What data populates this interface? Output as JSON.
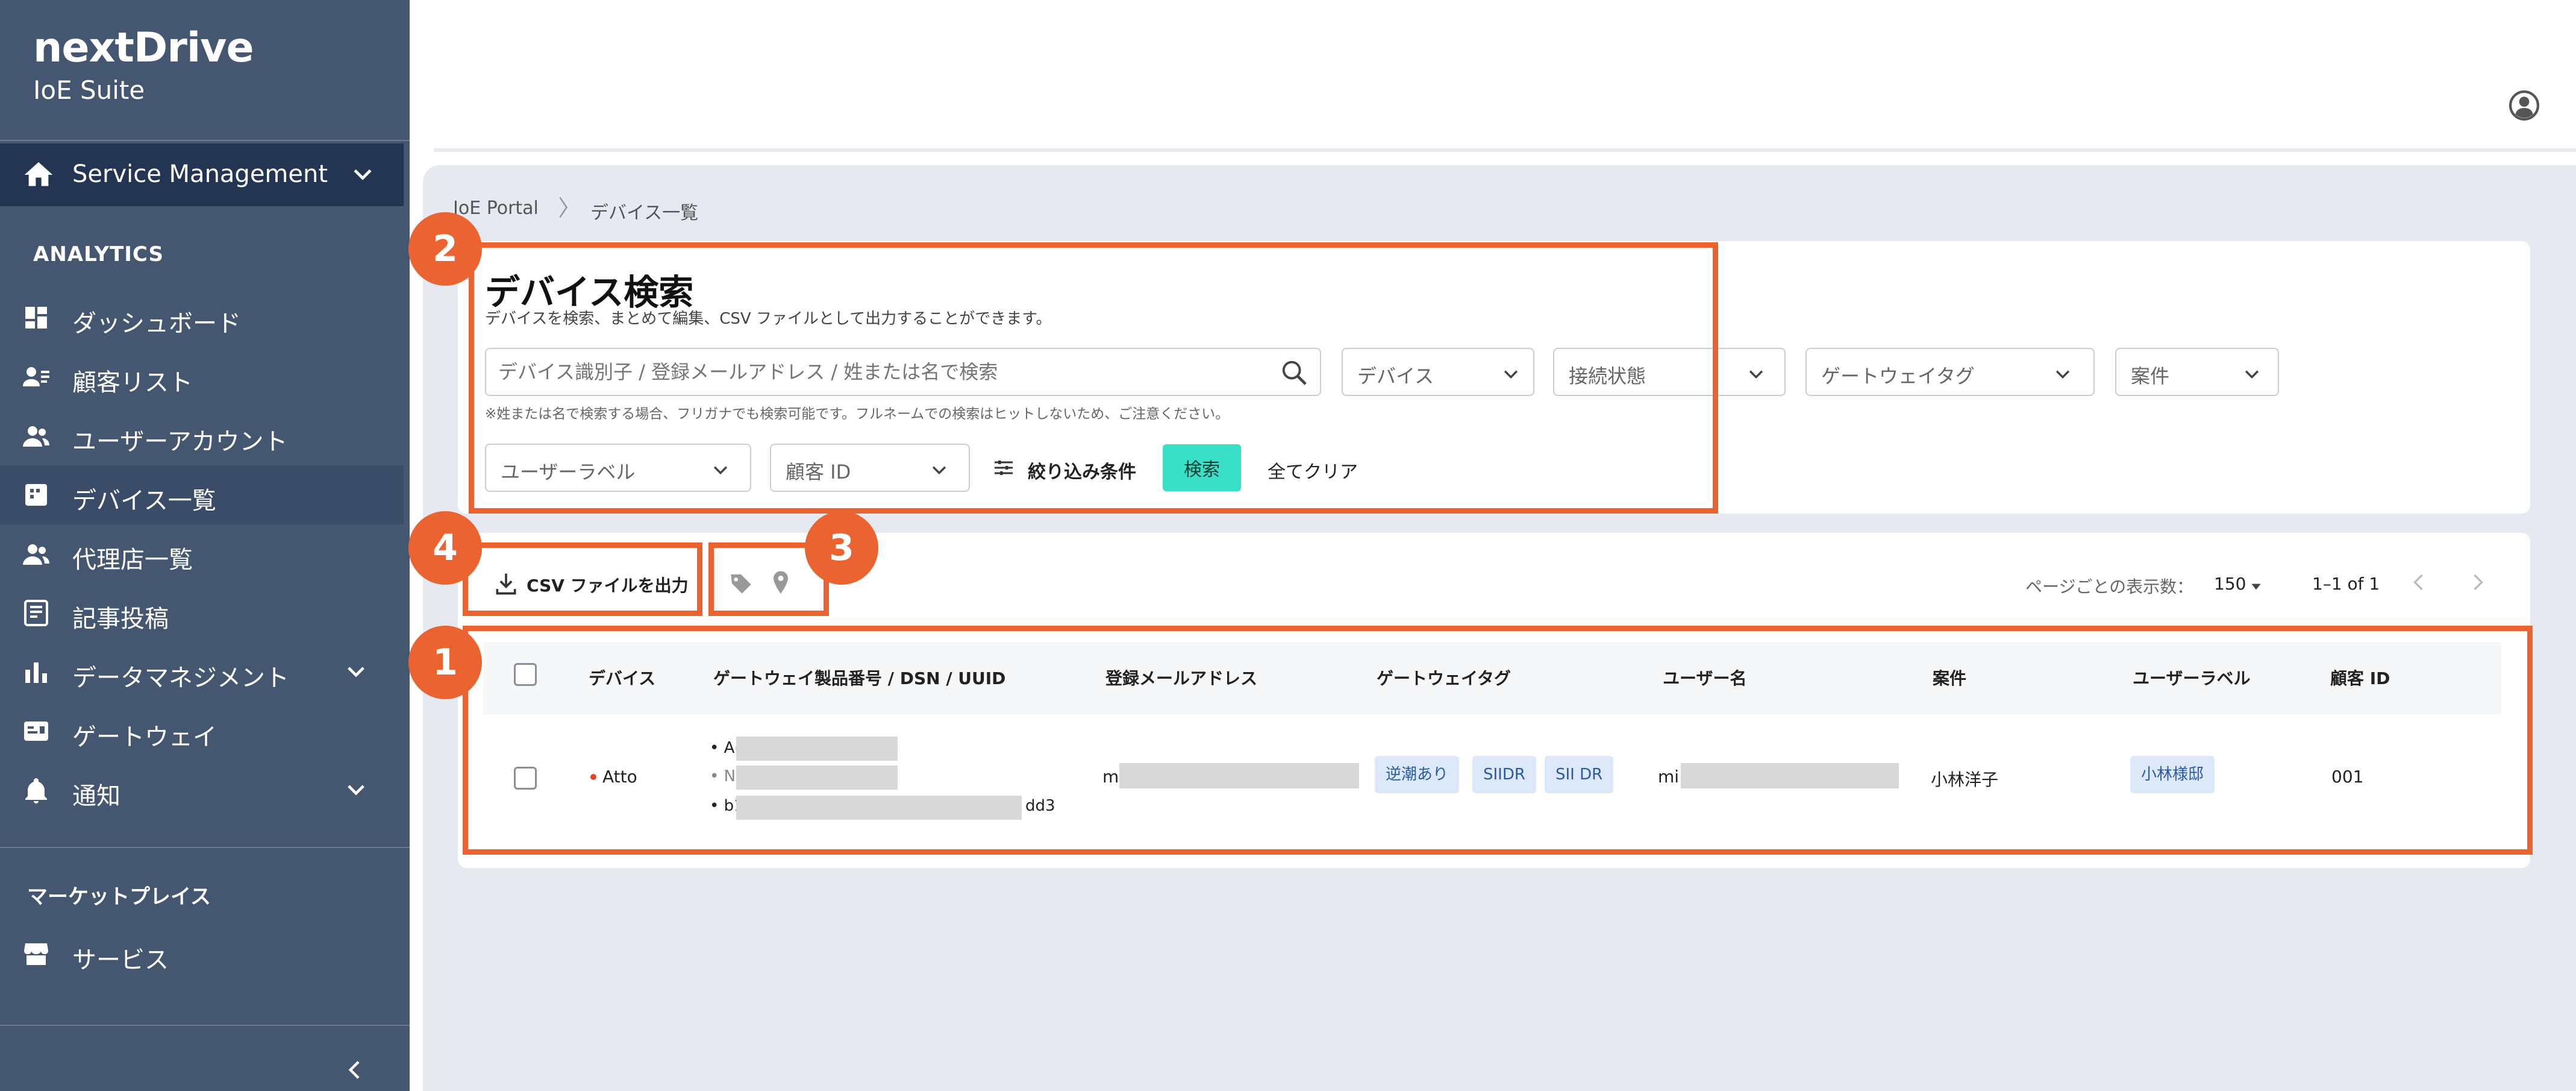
{
  "brand": {
    "name": "nextDrive",
    "product": "IoE Suite"
  },
  "sidebar": {
    "service": {
      "label": "Service Management",
      "icon": "home-icon"
    },
    "section_label": "ANALYTICS",
    "items": [
      {
        "label": "ダッシュボード",
        "icon": "dashboard-icon"
      },
      {
        "label": "顧客リスト",
        "icon": "customer-list-icon"
      },
      {
        "label": "ユーザーアカウント",
        "icon": "users-icon"
      },
      {
        "label": "デバイス一覧",
        "icon": "device-icon",
        "active": true
      },
      {
        "label": "代理店一覧",
        "icon": "agency-icon"
      },
      {
        "label": "記事投稿",
        "icon": "article-icon"
      },
      {
        "label": "データマネジメント",
        "icon": "chart-icon",
        "expandable": true
      },
      {
        "label": "ゲートウェイ",
        "icon": "gateway-icon"
      },
      {
        "label": "通知",
        "icon": "bell-icon",
        "expandable": true
      }
    ],
    "marketplace_label": "マーケットプレイス",
    "marketplace_items": [
      {
        "label": "サービス",
        "icon": "store-icon"
      }
    ]
  },
  "breadcrumb": {
    "root": "IoE Portal",
    "current": "デバイス一覧"
  },
  "search": {
    "title": "デバイス検索",
    "description": "デバイスを検索、まとめて編集、CSV ファイルとして出力することができます。",
    "placeholder": "デバイス識別子 / 登録メールアドレス / 姓または名で検索",
    "note": "※姓または名で検索する場合、フリガナでも検索可能です。フルネームでの検索はヒットしないため、ご注意ください。",
    "dropdowns": [
      "デバイス",
      "接続状態",
      "ゲートウェイタグ",
      "案件"
    ],
    "dropdowns_row2": [
      "ユーザーラベル",
      "顧客 ID"
    ],
    "filter_label": "絞り込み条件",
    "search_button": "検索",
    "clear_label": "全てクリア"
  },
  "toolbar": {
    "csv_label": "CSV ファイルを出力",
    "per_page_label": "ページごとの表示数：",
    "per_page_value": "150",
    "range_label": "1–1 of 1"
  },
  "callouts": [
    "1",
    "2",
    "3",
    "4"
  ],
  "table": {
    "headers": [
      "デバイス",
      "ゲートウェイ製品番号 / DSN / UUID",
      "登録メールアドレス",
      "ゲートウェイタグ",
      "ユーザー名",
      "案件",
      "ユーザーラベル",
      "顧客 ID"
    ],
    "rows": [
      {
        "device": "Atto",
        "ids": [
          "• A(",
          "• NI",
          "• b1",
          "dd3"
        ],
        "email_prefix": "mi",
        "tags": [
          "逆潮あり",
          "SIIDR",
          "SII DR"
        ],
        "user_prefix": "mi",
        "project": "小林洋子",
        "user_label": "小林様邸",
        "customer_id": "001"
      }
    ]
  },
  "colors": {
    "sidebar": "#455670",
    "accent": "#38e0c8",
    "highlight": "#ec6332",
    "chip": "#dde9f8"
  }
}
